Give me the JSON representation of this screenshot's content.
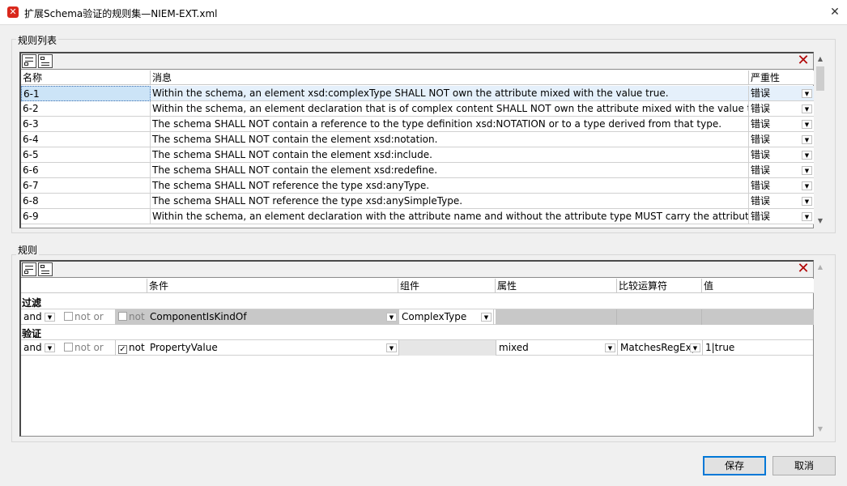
{
  "window": {
    "title": "扩展Schema验证的规则集—NIEM-EXT.xml",
    "close_glyph": "✕",
    "icon_glyph": "✕"
  },
  "rule_list": {
    "group_label": "规则列表",
    "columns": {
      "name": "名称",
      "message": "消息",
      "severity": "严重性"
    },
    "rows": [
      {
        "name": "6-1",
        "message": "Within the schema, an element xsd:complexType SHALL NOT own the attribute mixed with the value true.",
        "severity": "错误"
      },
      {
        "name": "6-2",
        "message": "Within the schema, an element declaration that is of complex content SHALL NOT own the attribute mixed with the value true.",
        "severity": "错误"
      },
      {
        "name": "6-3",
        "message": "The schema SHALL NOT contain a reference to the type definition xsd:NOTATION or to a type derived from that type.",
        "severity": "错误"
      },
      {
        "name": "6-4",
        "message": "The schema SHALL NOT contain the element xsd:notation.",
        "severity": "错误"
      },
      {
        "name": "6-5",
        "message": "The schema SHALL NOT contain the element xsd:include.",
        "severity": "错误"
      },
      {
        "name": "6-6",
        "message": "The schema SHALL NOT contain the element xsd:redefine.",
        "severity": "错误"
      },
      {
        "name": "6-7",
        "message": "The schema SHALL NOT reference the type xsd:anyType.",
        "severity": "错误"
      },
      {
        "name": "6-8",
        "message": "The schema SHALL NOT reference the type xsd:anySimpleType.",
        "severity": "错误"
      },
      {
        "name": "6-9",
        "message": "Within the schema, an element declaration with the attribute name and without the attribute type MUST carry the attribute abstract with t...",
        "severity": "错误"
      }
    ]
  },
  "rule": {
    "group_label": "规则",
    "columns": {
      "condition": "条件",
      "component": "组件",
      "attribute": "属性",
      "operator": "比较运算符",
      "value": "值"
    },
    "filter": {
      "label": "过滤",
      "and": "and",
      "notor": "not or",
      "not": "not",
      "condition": "ComponentIsKindOf",
      "component": "ComplexType"
    },
    "validation": {
      "label": "验证",
      "and": "and",
      "notor": "not or",
      "not": "not",
      "not_checked_glyph": "✓",
      "condition": "PropertyValue",
      "attribute": "mixed",
      "operator": "MatchesRegExp",
      "value": "1|true"
    }
  },
  "buttons": {
    "save": "保存",
    "cancel": "取消"
  },
  "glyphs": {
    "dropdown": "▼",
    "scroll_up": "▲",
    "scroll_down": "▼",
    "delete": "✕"
  },
  "colors": {
    "accent": "#0078d7",
    "delete": "#b00000",
    "selected_row": "#e5f0fb"
  }
}
